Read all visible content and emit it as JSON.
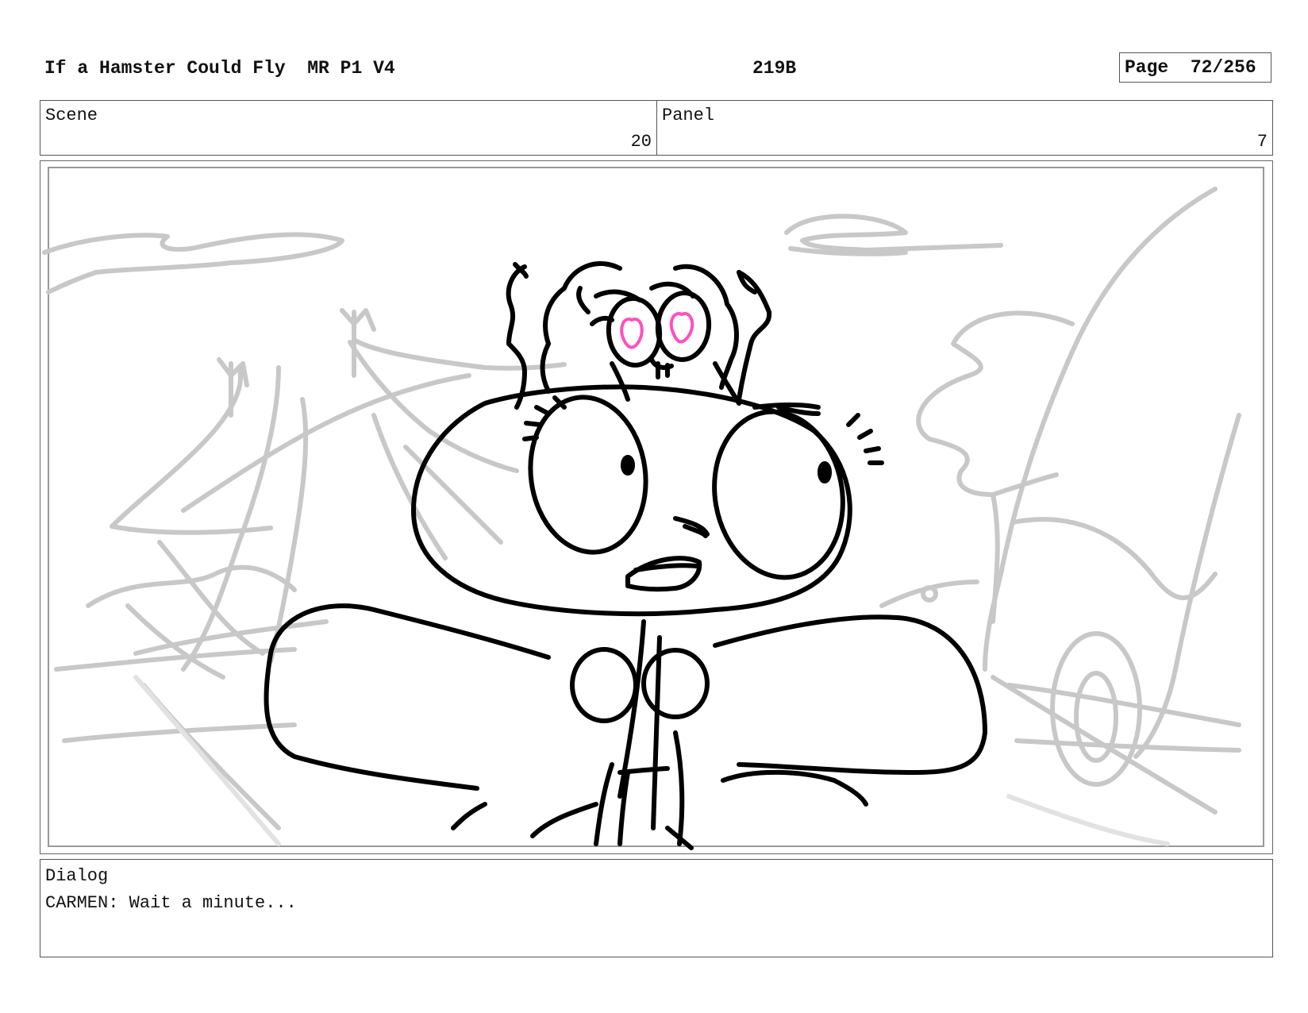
{
  "header": {
    "title": "If a Hamster Could Fly  MR P1 V4",
    "code": "219B",
    "page_label": "Page",
    "page_value": "72/256"
  },
  "scene": {
    "label": "Scene",
    "value": "20"
  },
  "panel": {
    "label": "Panel",
    "value": "7"
  },
  "dialog": {
    "label": "Dialog",
    "text": "CARMEN: Wait a minute..."
  },
  "artwork": {
    "sketch_color": "#000000",
    "background_sketch_color": "#c8c8c8",
    "highlight_color": "#ff4fbf"
  }
}
